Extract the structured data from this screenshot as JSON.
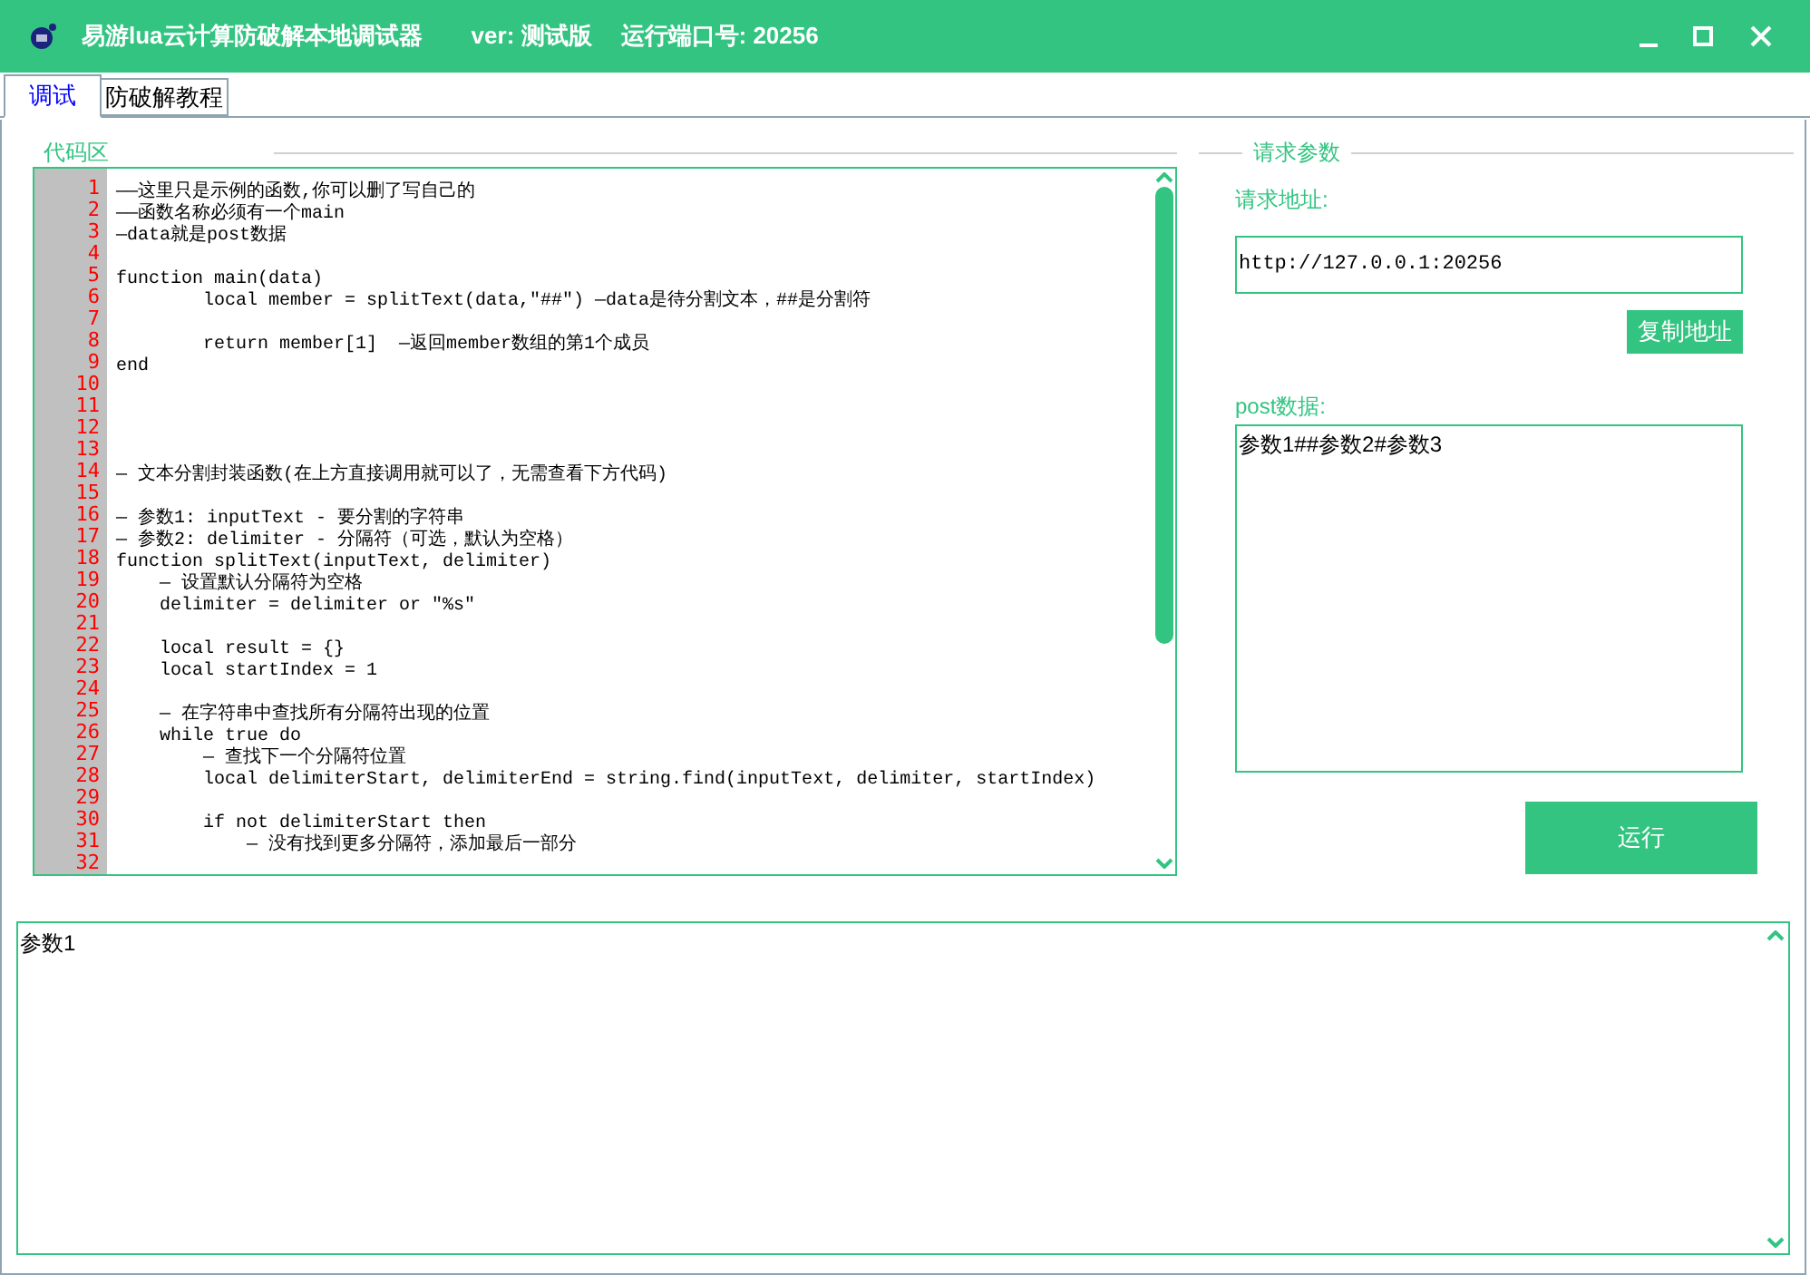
{
  "window": {
    "title": "易游lua云计算防破解本地调试器",
    "version": "ver: 测试版",
    "port": "运行端口号: 20256"
  },
  "tabs": [
    {
      "label": "调试",
      "selected": true
    },
    {
      "label": "防破解教程",
      "selected": false
    }
  ],
  "code_panel": {
    "title": "代码区",
    "lines": [
      {
        "number": "1",
        "text": "——这里只是示例的函数,你可以删了写自己的"
      },
      {
        "number": "2",
        "text": "——函数名称必须有一个main"
      },
      {
        "number": "3",
        "text": "—data就是post数据"
      },
      {
        "number": "4"
      },
      {
        "number": "5",
        "text": "function main(data)"
      },
      {
        "number": "6",
        "text": "        local member = splitText(data,\"##\") —data是待分割文本，##是分割符"
      },
      {
        "number": "7"
      },
      {
        "number": "8",
        "text": "        return member[1]  —返回member数组的第1个成员"
      },
      {
        "number": "9",
        "text": "end"
      },
      {
        "number": "10"
      },
      {
        "number": "11"
      },
      {
        "number": "12"
      },
      {
        "number": "13"
      },
      {
        "number": "14",
        "text": "— 文本分割封装函数(在上方直接调用就可以了，无需查看下方代码)"
      },
      {
        "number": "15"
      },
      {
        "number": "16",
        "text": "— 参数1: inputText - 要分割的字符串"
      },
      {
        "number": "17",
        "text": "— 参数2: delimiter - 分隔符（可选，默认为空格）"
      },
      {
        "number": "18",
        "text": "function splitText(inputText, delimiter)"
      },
      {
        "number": "19",
        "text": "    — 设置默认分隔符为空格"
      },
      {
        "number": "20",
        "text": "    delimiter = delimiter or \"%s\""
      },
      {
        "number": "21"
      },
      {
        "number": "22",
        "text": "    local result = {}"
      },
      {
        "number": "23",
        "text": "    local startIndex = 1"
      },
      {
        "number": "24"
      },
      {
        "number": "25",
        "text": "    — 在字符串中查找所有分隔符出现的位置"
      },
      {
        "number": "26",
        "text": "    while true do"
      },
      {
        "number": "27",
        "text": "        — 查找下一个分隔符位置"
      },
      {
        "number": "28",
        "text": "        local delimiterStart, delimiterEnd = string.find(inputText, delimiter, startIndex)"
      },
      {
        "number": "29"
      },
      {
        "number": "30",
        "text": "        if not delimiterStart then"
      },
      {
        "number": "31",
        "text": "            — 没有找到更多分隔符，添加最后一部分"
      },
      {
        "number": "32"
      }
    ]
  },
  "request_panel": {
    "title": "请求参数",
    "url_label": "请求地址:",
    "url": "http://127.0.0.1:20256",
    "copy_button": "复制地址",
    "post_label": "post数据:",
    "post_data": "参数1##参数2#参数3",
    "run_button": "运行"
  },
  "output": {
    "text": "参数1"
  }
}
